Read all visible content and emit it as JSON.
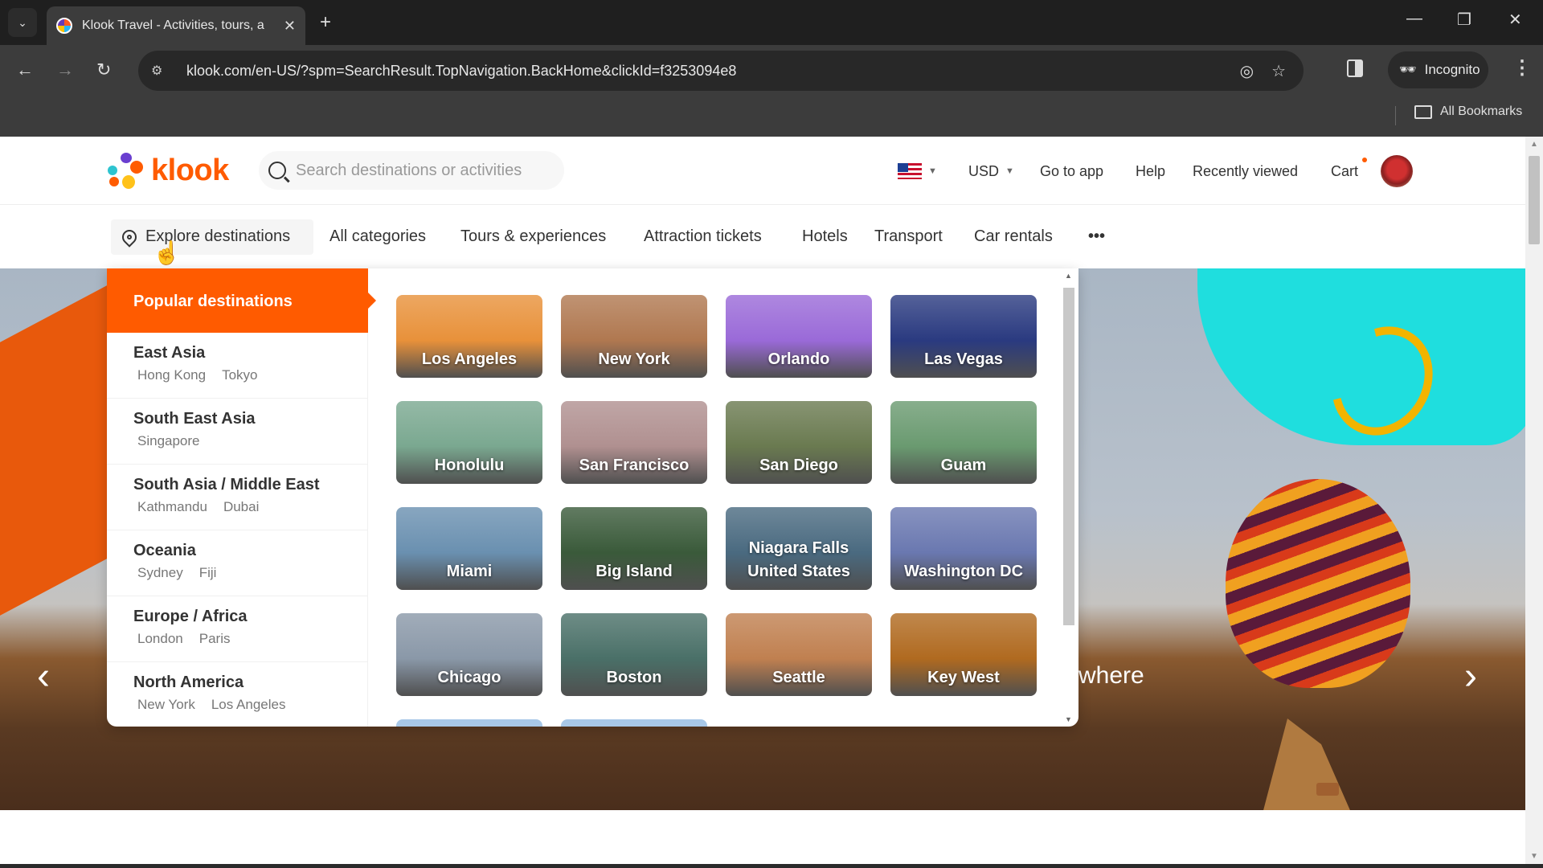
{
  "browser": {
    "tab_title": "Klook Travel - Activities, tours, a",
    "url": "klook.com/en-US/?spm=SearchResult.TopNavigation.BackHome&clickId=f3253094e8",
    "incognito_label": "Incognito",
    "all_bookmarks_label": "All Bookmarks"
  },
  "header": {
    "logo_text": "klook",
    "search_placeholder": "Search destinations or activities",
    "currency": "USD",
    "links": [
      "Go to app",
      "Help",
      "Recently viewed",
      "Cart"
    ]
  },
  "nav": {
    "items": [
      "Explore destinations",
      "All categories",
      "Tours & experiences",
      "Attraction tickets",
      "Hotels",
      "Transport",
      "Car rentals"
    ],
    "more": "•••"
  },
  "banner": {
    "partial_text": "where"
  },
  "dropdown": {
    "popular_label": "Popular destinations",
    "regions": [
      {
        "name": "East Asia",
        "cities": [
          "Hong Kong",
          "Tokyo"
        ]
      },
      {
        "name": "South East Asia",
        "cities": [
          "Singapore"
        ]
      },
      {
        "name": "South Asia / Middle East",
        "cities": [
          "Kathmandu",
          "Dubai"
        ]
      },
      {
        "name": "Oceania",
        "cities": [
          "Sydney",
          "Fiji"
        ]
      },
      {
        "name": "Europe / Africa",
        "cities": [
          "London",
          "Paris"
        ]
      },
      {
        "name": "North America",
        "cities": [
          "New York",
          "Los Angeles"
        ]
      }
    ],
    "destinations": [
      {
        "name": "Los Angeles",
        "bg": "#e8913a"
      },
      {
        "name": "New York",
        "bg": "#b07850"
      },
      {
        "name": "Orlando",
        "bg": "#9a6ad8"
      },
      {
        "name": "Las Vegas",
        "bg": "#2a3a80"
      },
      {
        "name": "Honolulu",
        "bg": "#7aa890"
      },
      {
        "name": "San Francisco",
        "bg": "#b09090"
      },
      {
        "name": "San Diego",
        "bg": "#6a7a50"
      },
      {
        "name": "Guam",
        "bg": "#6a9a70"
      },
      {
        "name": "Miami",
        "bg": "#6a90b0"
      },
      {
        "name": "Big Island",
        "bg": "#3a5a3a"
      },
      {
        "name": "Niagara Falls\nUnited States",
        "bg": "#4a6a80"
      },
      {
        "name": "Washington DC",
        "bg": "#6a78b0"
      },
      {
        "name": "Chicago",
        "bg": "#8a98a8"
      },
      {
        "name": "Boston",
        "bg": "#4a7068"
      },
      {
        "name": "Seattle",
        "bg": "#c08050"
      },
      {
        "name": "Key West",
        "bg": "#b06a20"
      }
    ]
  },
  "colors": {
    "brand": "#ff5b00"
  }
}
